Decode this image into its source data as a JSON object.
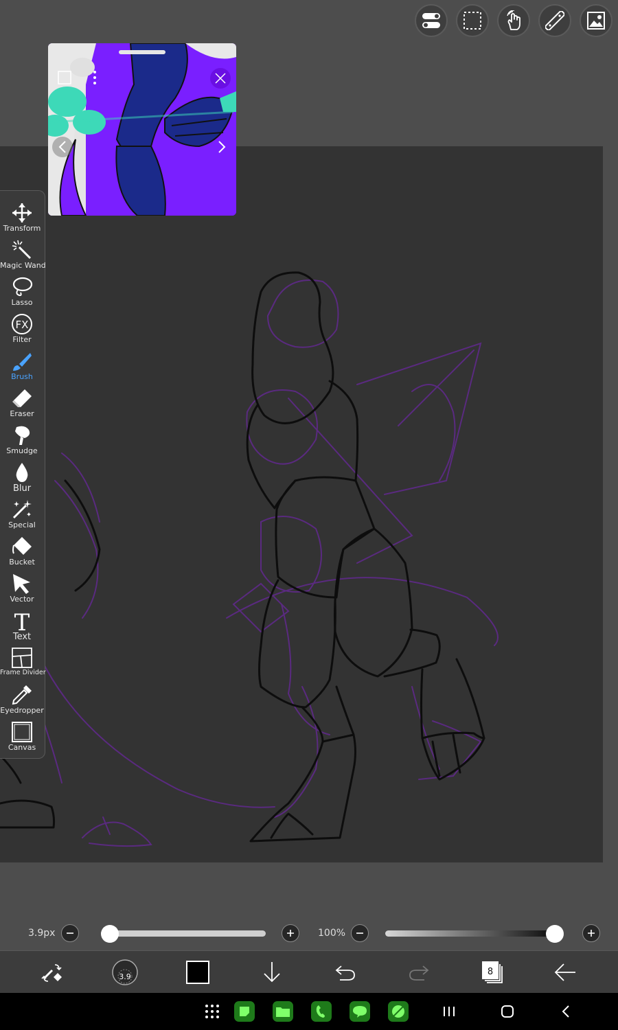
{
  "top_tools": [
    {
      "name": "toggle-icon"
    },
    {
      "name": "selection-icon"
    },
    {
      "name": "hand-gesture-icon"
    },
    {
      "name": "ruler-icon"
    },
    {
      "name": "image-icon"
    }
  ],
  "reference_window": {
    "menu_icon": "more-vertical-icon",
    "close_icon": "close-icon",
    "prev_icon": "chevron-left-icon",
    "next_icon": "chevron-right-icon"
  },
  "tools": {
    "transform": "Transform",
    "magic_wand": "Magic Wand",
    "lasso": "Lasso",
    "filter": "Filter",
    "filter_icon_text": "FX",
    "brush": "Brush",
    "eraser": "Eraser",
    "smudge": "Smudge",
    "blur": "Blur",
    "special": "Special",
    "bucket": "Bucket",
    "vector": "Vector",
    "text": "Text",
    "text_icon_glyph": "T",
    "frame_divider": "Frame Divider",
    "eyedropper": "Eyedropper",
    "canvas": "Canvas",
    "active": "Brush"
  },
  "brush_size": {
    "label": "3.9px",
    "value_fraction": 0.0
  },
  "brush_opacity": {
    "label": "100%",
    "value_fraction": 1.0
  },
  "bottom_bar": {
    "brush_size_badge": "3.9",
    "current_color": "#000000",
    "layer_count": "8"
  },
  "colors": {
    "accent": "#4aa3ff",
    "canvas": "#333333",
    "background": "#4d4d4d",
    "sketch_purple": "#5a2a80"
  }
}
